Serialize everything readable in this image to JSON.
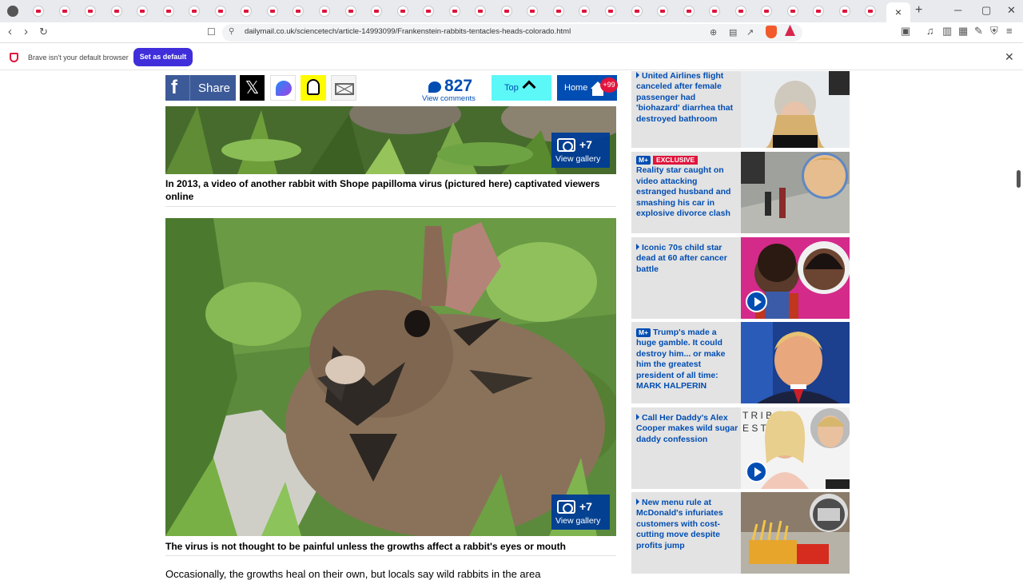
{
  "browser": {
    "active_tab_close": "×",
    "new_tab": "+",
    "url": "dailymail.co.uk/sciencetech/article-14993099/Frankenstein-rabbits-tentacles-heads-colorado.html",
    "infobar_text": "Brave isn't your default browser",
    "set_default_label": "Set as default"
  },
  "share": {
    "facebook_share_label": "Share",
    "comment_count": "827",
    "comment_label": "View comments",
    "top_label": "Top",
    "home_label": "Home",
    "home_badge": "+99"
  },
  "article": {
    "gallery_count": "+7",
    "gallery_label": "View gallery",
    "caption1": "In 2013, a video of another rabbit with Shope papilloma virus (pictured here) captivated viewers online",
    "caption2": "The virus is not thought to be painful unless the growths affect a rabbit's eyes or mouth",
    "body_snippet": "Occasionally, the growths heal on their own, but locals say wild rabbits in the area"
  },
  "sidebar": {
    "items": [
      {
        "label": "United Airlines flight canceled after female passenger had 'biohazard' diarrhea that destroyed bathroom"
      },
      {
        "badge": "M+",
        "tag": "EXCLUSIVE",
        "label": "Reality star caught on video attacking estranged husband and smashing his car in explosive divorce clash"
      },
      {
        "label": "Iconic 70s child star dead at 60 after cancer battle"
      },
      {
        "badge": "M+",
        "label": "Trump's made a huge gamble. It could destroy him... or make him the greatest president of all time: MARK HALPERIN"
      },
      {
        "label": "Call Her Daddy's Alex Cooper makes wild sugar daddy confession"
      },
      {
        "label": "New menu rule at McDonald's infuriates customers with cost-cutting move despite profits jump"
      }
    ]
  },
  "colors": {
    "dm_blue": "#004db3",
    "accent_red": "#e0143c",
    "facebook": "#3d5a98",
    "top_cyan": "#5cf7f7",
    "brave_purple": "#3f2ed9"
  }
}
